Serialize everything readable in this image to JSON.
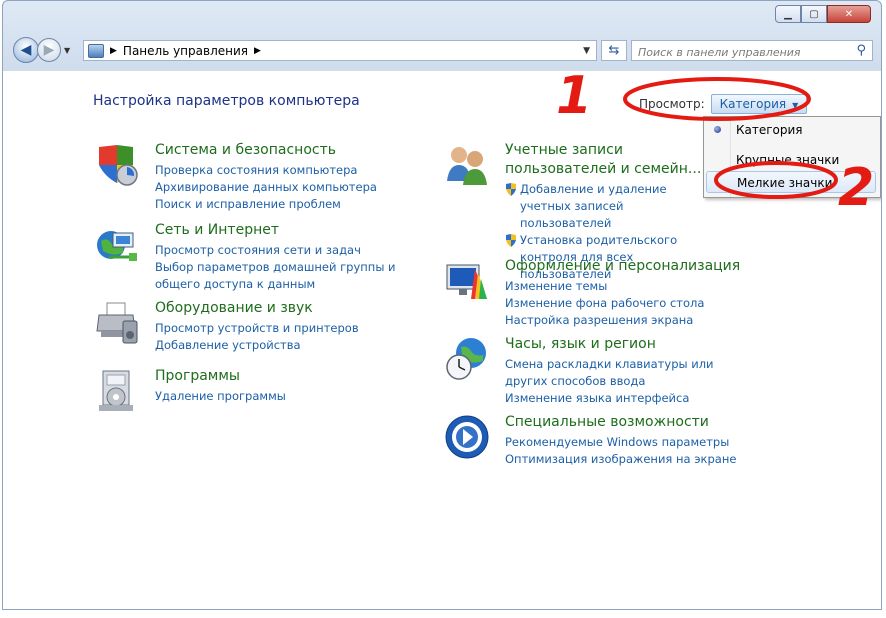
{
  "window": {
    "address": "Панель управления",
    "search_placeholder": "Поиск в панели управления",
    "buttons": [
      "minimize",
      "maximize",
      "close"
    ]
  },
  "page": {
    "title": "Настройка параметров компьютера",
    "view_label": "Просмотр:",
    "view_value": "Категория"
  },
  "view_menu": {
    "items": [
      {
        "label": "Категория",
        "selected": true
      },
      {
        "label": "Крупные значки",
        "selected": false
      },
      {
        "label": "Мелкие значки",
        "selected": false
      }
    ]
  },
  "categories": [
    {
      "title": "Система и безопасность",
      "icon": "shield-icon",
      "links": [
        "Проверка состояния компьютера",
        "Архивирование данных компьютера",
        "Поиск и исправление проблем"
      ]
    },
    {
      "title": "Сеть и Интернет",
      "icon": "network-globe-icon",
      "links": [
        "Просмотр состояния сети и задач",
        "Выбор параметров домашней группы и общего доступа к данным"
      ]
    },
    {
      "title": "Оборудование и звук",
      "icon": "printer-icon",
      "links": [
        "Просмотр устройств и принтеров",
        "Добавление устройства"
      ]
    },
    {
      "title": "Программы",
      "icon": "programs-icon",
      "links": [
        "Удаление программы"
      ]
    },
    {
      "title": "Учетные записи пользователей и семейн...",
      "icon": "users-icon",
      "links": [
        "Добавление и удаление учетных записей пользователей",
        "Установка родительского контроля для всех пользователей"
      ]
    },
    {
      "title": "Оформление и персонализация",
      "icon": "personalization-icon",
      "links": [
        "Изменение темы",
        "Изменение фона рабочего стола",
        "Настройка разрешения экрана"
      ]
    },
    {
      "title": "Часы, язык и регион",
      "icon": "clock-globe-icon",
      "links": [
        "Смена раскладки клавиатуры или других способов ввода",
        "Изменение языка интерфейса"
      ]
    },
    {
      "title": "Специальные возможности",
      "icon": "accessibility-icon",
      "links": [
        "Рекомендуемые Windows параметры",
        "Оптимизация изображения на экране"
      ]
    }
  ],
  "annotations": {
    "one": "1",
    "two": "2"
  },
  "colors": {
    "heading": "#1e6d1c",
    "link": "#1c5fa6",
    "title": "#1e3287",
    "annotation": "#e41b13"
  }
}
